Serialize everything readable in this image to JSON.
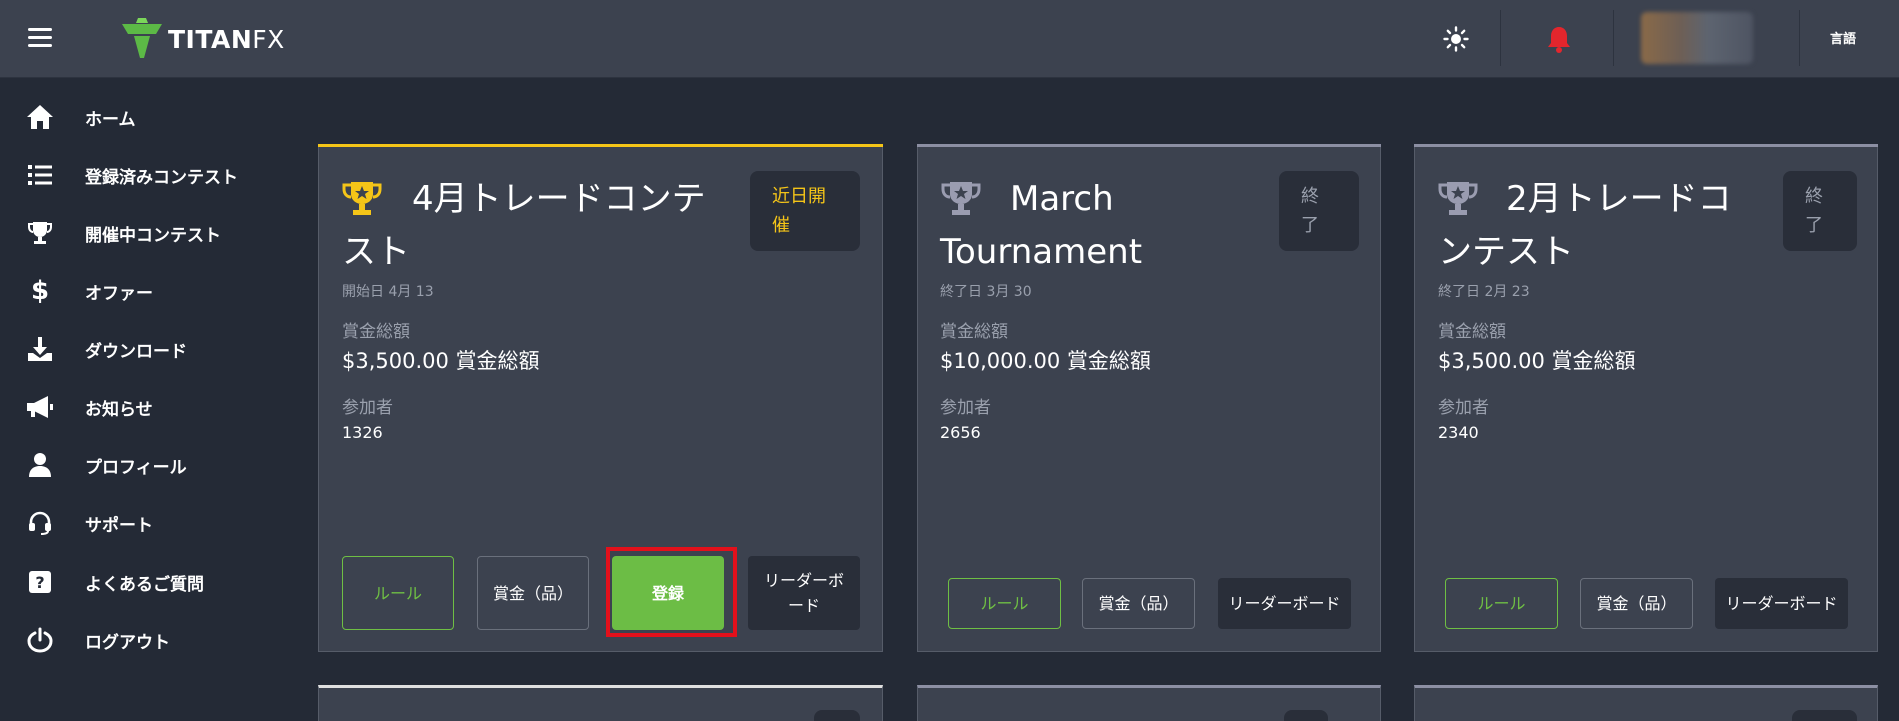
{
  "header": {
    "menu_icon": "hamburger-menu-icon",
    "logo_text": "TITAN",
    "logo_text_fx": "FX",
    "theme_icon": "sun-icon",
    "notification_icon": "bell-icon",
    "language_label": "言語",
    "colors": {
      "background": "#3c424f",
      "bell": "#e3262d",
      "logo_green": "#5cb946"
    }
  },
  "sidebar": {
    "items": [
      {
        "label": "ホーム",
        "icon": "home-icon"
      },
      {
        "label": "登録済みコンテスト",
        "icon": "list-icon"
      },
      {
        "label": "開催中コンテスト",
        "icon": "trophy-icon"
      },
      {
        "label": "オファー",
        "icon": "dollar-icon"
      },
      {
        "label": "ダウンロード",
        "icon": "download-icon"
      },
      {
        "label": "お知らせ",
        "icon": "megaphone-icon"
      },
      {
        "label": "プロフィール",
        "icon": "user-icon"
      },
      {
        "label": "サポート",
        "icon": "headset-icon"
      },
      {
        "label": "よくあるご質問",
        "icon": "question-icon"
      },
      {
        "label": "ログアウト",
        "icon": "power-icon"
      }
    ]
  },
  "cards": [
    {
      "title_line1": "4月トレードコンテ",
      "title_line2": "スト",
      "status_line1": "近日開",
      "status_line2": "催",
      "date": "開始日 4月 13",
      "prize_label": "賞金総額",
      "prize": "$3,500.00 賞金総額",
      "participants_label": "参加者",
      "participants": "1326",
      "rules_button": "ルール",
      "prize_button": "賞金（品）",
      "register_button": "登録",
      "leaderboard_line1": "リーダーボ",
      "leaderboard_line2": "ード",
      "accent": "#f5c518",
      "trophy_color": "#f5c518",
      "status_color": "#f5c518"
    },
    {
      "title_line1": "March",
      "title_line2": "Tournament",
      "status_line1": "終",
      "status_line2": "了",
      "date": "終了日 3月 30",
      "prize_label": "賞金総額",
      "prize": "$10,000.00 賞金総額",
      "participants_label": "参加者",
      "participants": "2656",
      "rules_button": "ルール",
      "prize_button": "賞金（品）",
      "leaderboard_button": "リーダーボード",
      "accent": "#8c8fa3",
      "trophy_color": "#9a9cb0",
      "status_color": "#9aa0ad"
    },
    {
      "title_line1": "2月トレードコ",
      "title_line2": "ンテスト",
      "status_line1": "終",
      "status_line2": "了",
      "date": "終了日 2月 23",
      "prize_label": "賞金総額",
      "prize": "$3,500.00 賞金総額",
      "participants_label": "参加者",
      "participants": "2340",
      "rules_button": "ルール",
      "prize_button": "賞金（品）",
      "leaderboard_button": "リーダーボード",
      "accent": "#8c8fa3",
      "trophy_color": "#9a9cb0",
      "status_color": "#9aa0ad"
    }
  ]
}
